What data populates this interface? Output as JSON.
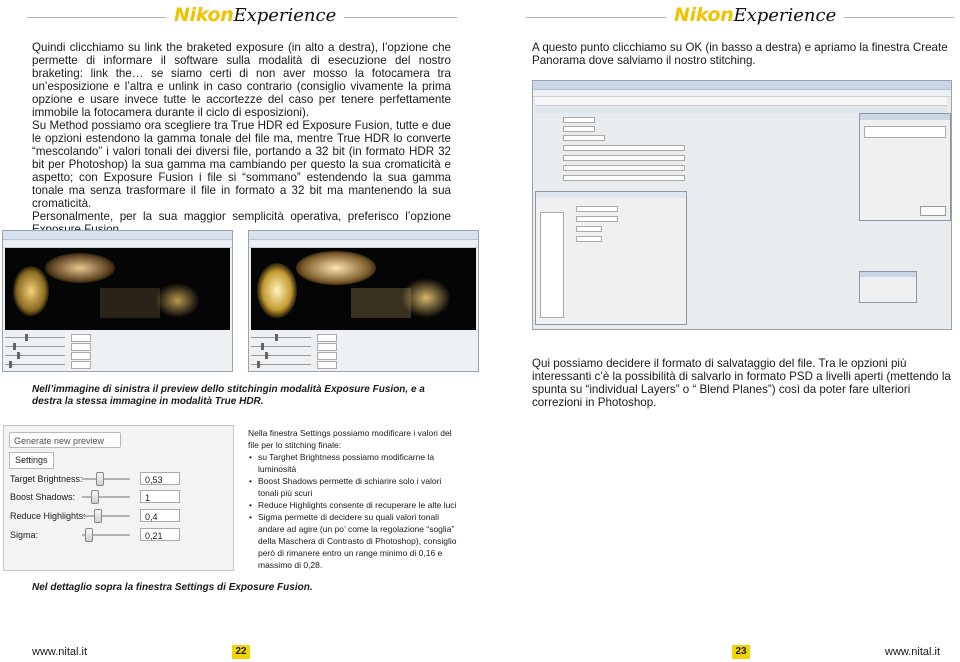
{
  "left_page": {
    "brand": {
      "nikon": "Nikon",
      "experience": "Experience"
    },
    "body_paragraphs": [
      "Quindi clicchiamo su link the braketed exposure (in alto a destra), l’opzione che permette di informare il software sulla modalità di esecuzione del nostro braketing: link the… se siamo certi di non aver mosso la fotocamera tra un’esposizione e l’altra e unlink in caso contrario (consiglio vivamente la prima opzione e usare invece tutte le accortezze del caso per tenere perfettamente immobile la fotocamera durante il ciclo di esposizioni).",
      "Su Method possiamo ora scegliere tra True HDR ed Exposure Fusion, tutte e due le opzioni estendono la gamma tonale del file ma, mentre True HDR lo converte “mescolando” i valori tonali dei diversi file, portando a 32 bit (in formato HDR 32 bit per Photoshop) la sua gamma ma cambiando per questo la sua cromaticità e aspetto; con Exposure Fusion i file si “sommano” estendendo la sua gamma tonale ma senza trasformare il file in formato a 32 bit ma mantenendo la sua cromaticità.",
      "Personalmente, per la sua maggior semplicità operativa, preferisco l’opzione Exposure Fusion."
    ],
    "caption_previews": "Nell’immagine di sinistra il preview dello stitchingin modalità Exposure Fusion, e a destra la stessa immagine in modalità True HDR.",
    "settings_panel": {
      "generate_button": "Generate new preview",
      "tab": "Settings",
      "rows": [
        {
          "label": "Target Brightness:",
          "value": "0,53",
          "level": 0.29
        },
        {
          "label": "Boost Shadows:",
          "value": "1",
          "level": 0.2
        },
        {
          "label": "Reduce Highlights:",
          "value": "0,4",
          "level": 0.25
        },
        {
          "label": "Sigma:",
          "value": "0,21",
          "level": 0.05
        }
      ]
    },
    "notes": {
      "intro": "Nella finestra Settings possiamo modificare i valori del file per lo stitching finale:",
      "bullets": [
        "su Targhet Brightness possiamo modificarne la luminosità",
        "Boost Shadows permette di schiarire solo i valori tonali più scuri",
        "Reduce Highlights consente di recuperare le alte luci",
        "Sigma permette di decidere su quali valori tonali andare ad agire (un po’ come la regolazione “soglia” della Maschera di Contrasto di Photoshop), consiglio però di rimanere entro un range minimo di 0,16 e massimo di 0,28."
      ]
    },
    "caption_settings": "Nel dettaglio sopra la finestra Settings di Exposure Fusion.",
    "footer": {
      "url": "www.nital.it",
      "page": "22"
    }
  },
  "right_page": {
    "brand": {
      "nikon": "Nikon",
      "experience": "Experience"
    },
    "intro": "A questo punto clicchiamo su OK (in basso a destra) e apriamo la finestra Create Panorama dove salviamo il nostro stitching.",
    "format_text": "Qui possiamo decidere il formato di salvataggio del file. Tra le opzioni più interessanti c’è la possibilità di salvarlo in formato PSD a livelli aperti (mettendo la spunta su “individual Layers” o “ Blend Planes”) così da poter fare ulteriori correzioni in Photoshop.",
    "footer": {
      "url": "www.nital.it",
      "page": "23"
    }
  },
  "colors": {
    "brand_yellow": "#f2c200",
    "page_badge": "#f2d400"
  }
}
